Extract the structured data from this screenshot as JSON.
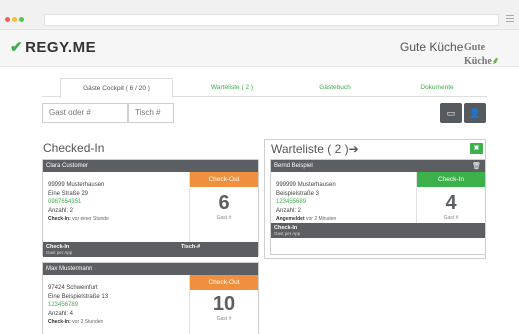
{
  "header": {
    "logo_text": "REGY.ME",
    "client_name": "Gute Küche",
    "client_logo_text": "Gute Küche"
  },
  "tabs": [
    {
      "label": "Gäste Cockpit ( 6 / 20 )",
      "active": true
    },
    {
      "label": "Warteliste ( 2 )",
      "active": false
    },
    {
      "label": "Gästebuch",
      "active": false
    },
    {
      "label": "Dokumente",
      "active": false
    }
  ],
  "search": {
    "guest_placeholder": "Gast oder #",
    "table_placeholder": "Tisch #"
  },
  "toolbar": {
    "icon1": "id-card-icon",
    "icon2": "add-user-icon"
  },
  "checked_in": {
    "title": "Checked-In",
    "cards": [
      {
        "name": "Clara Customer",
        "address1": "99999 Musterhausen",
        "address2": "Eine Straße 29",
        "phone": "0987654351",
        "count": "Anzahl: 2",
        "meta_label": "Check-In:",
        "meta_value": "vor einer Stunde",
        "action": "Check-Out",
        "table_number": "6",
        "table_label": "Gast #",
        "footer_title": "Check-In",
        "footer_sub": "Gast per App",
        "footer_mid": "Tisch-#"
      },
      {
        "name": "Max Mustermann",
        "address1": "97424 Schweinfurt",
        "address2": "Eine Beispielstraße 13",
        "phone": "123456789",
        "count": "Anzahl: 4",
        "meta_label": "Check-In:",
        "meta_value": "vor 2 Stunden",
        "action": "Check-Out",
        "table_number": "10",
        "table_label": "Gast #"
      }
    ]
  },
  "waitlist": {
    "title": "Warteliste ( 2 )➔",
    "cards": [
      {
        "name": "Bernd Beispiel",
        "address1": "999999 Musterhausen",
        "address2": "Beispielstraße 3",
        "phone": "123455689",
        "count": "Anzahl: 2",
        "meta_label": "Angemeldet",
        "meta_value": "vor 2 Minuten",
        "action": "Check-In",
        "table_number": "4",
        "table_label": "Gast #",
        "footer_title": "Check-In",
        "footer_sub": "Gast per App"
      }
    ]
  },
  "colors": {
    "accent_green": "#3cb04a",
    "checkout_orange": "#f0903e",
    "dark_gray": "#5b5f63"
  }
}
